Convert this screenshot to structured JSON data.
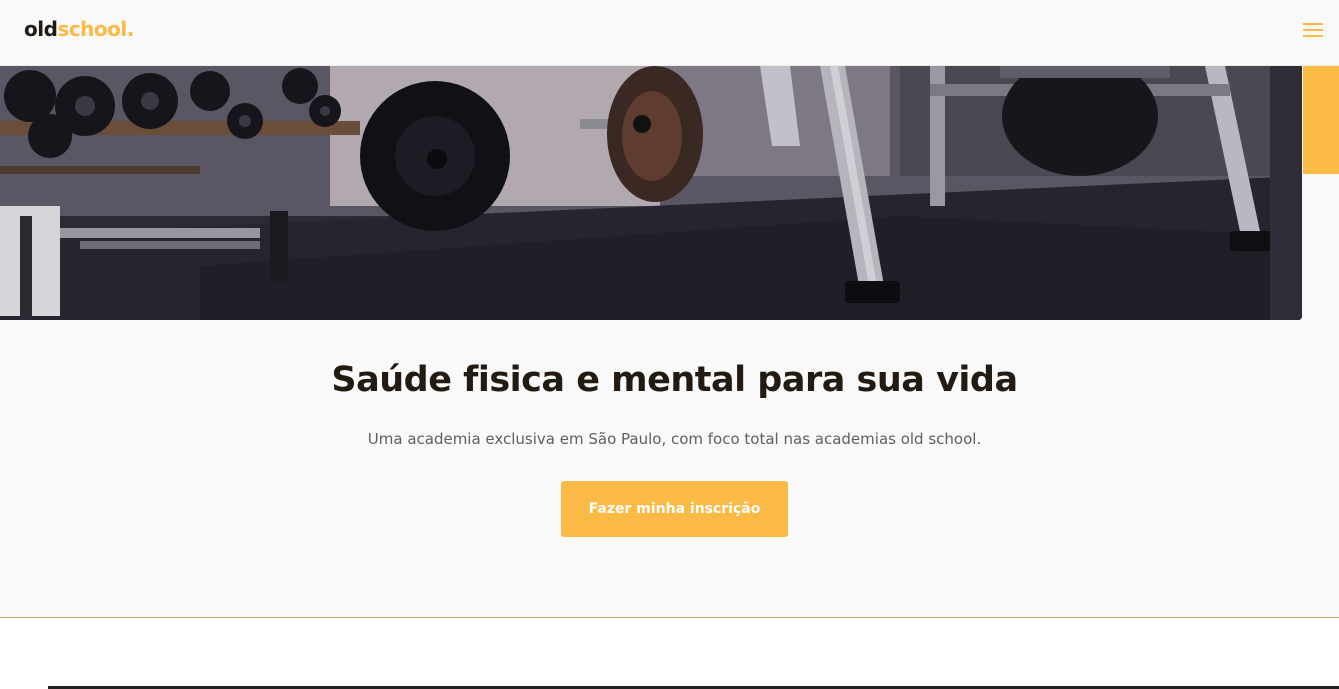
{
  "header": {
    "logo_part_a": "old",
    "logo_part_b": "school.",
    "menu_icon": "hamburger-menu-icon"
  },
  "hero": {
    "image_description_icon": "gym-photo",
    "title": "Saúde fisica e mental para sua vida",
    "subtitle": "Uma academia exclusiva em São Paulo, com foco total nas academias old school.",
    "cta_label": "Fazer minha inscrição"
  },
  "colors": {
    "accent": "#fbb945",
    "text_dark": "#231b12",
    "text_muted": "#5f5f5f",
    "background": "#f9f9f9"
  }
}
